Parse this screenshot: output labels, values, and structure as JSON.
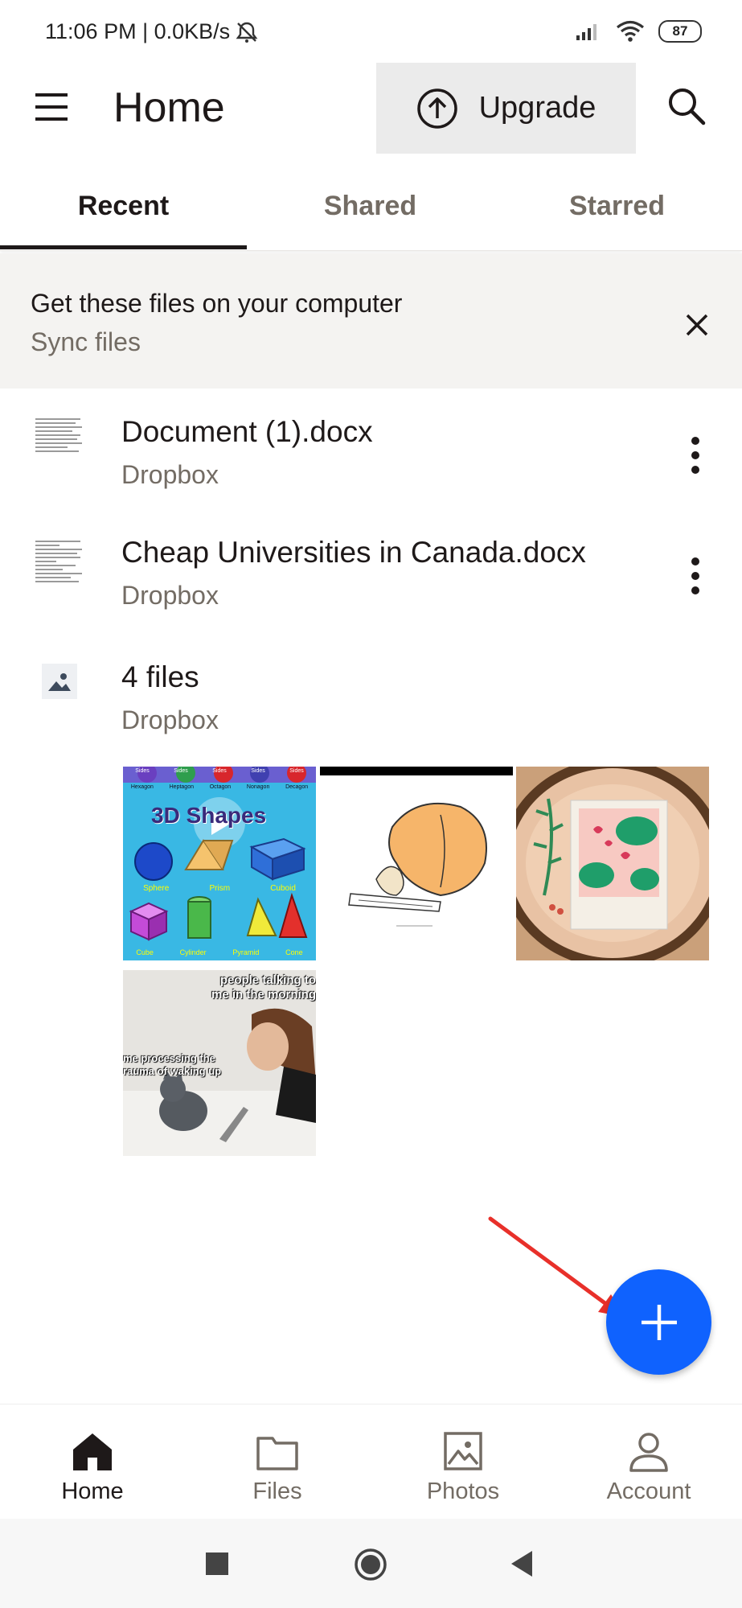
{
  "status_bar": {
    "time": "11:06 PM | 0.0KB/s",
    "battery": "87"
  },
  "app_bar": {
    "title": "Home",
    "upgrade_label": "Upgrade"
  },
  "tabs": [
    {
      "label": "Recent",
      "active": true
    },
    {
      "label": "Shared",
      "active": false
    },
    {
      "label": "Starred",
      "active": false
    }
  ],
  "banner": {
    "title": "Get these files on your computer",
    "subtitle": "Sync files"
  },
  "files": [
    {
      "name": "Document (1).docx",
      "location": "Dropbox",
      "icon": "docx-thumbnail"
    },
    {
      "name": "Cheap Universities in Canada.docx",
      "location": "Dropbox",
      "icon": "docx-thumbnail"
    },
    {
      "name": "4 files",
      "location": "Dropbox",
      "icon": "image-icon"
    }
  ],
  "photos": {
    "shapes": {
      "header_labels": [
        "Sides",
        "Sides",
        "Sides",
        "Sides",
        "Sides"
      ],
      "shape_names_top": [
        "Hexagon",
        "Heptagon",
        "Octagon",
        "Nonagon",
        "Decagon"
      ],
      "title": "3D Shapes",
      "row1": [
        "Sphere",
        "Prism",
        "Cuboid"
      ],
      "row2": [
        "Cube",
        "Cylinder",
        "Pyramid",
        "Cone"
      ]
    },
    "meme": {
      "top_text": "people talking to me in the morning",
      "side_text": "me processing the rauma of waking up"
    }
  },
  "bottom_nav": [
    {
      "label": "Home",
      "icon": "home-icon",
      "active": true
    },
    {
      "label": "Files",
      "icon": "folder-icon",
      "active": false
    },
    {
      "label": "Photos",
      "icon": "photos-icon",
      "active": false
    },
    {
      "label": "Account",
      "icon": "account-icon",
      "active": false
    }
  ],
  "colors": {
    "accent": "#0f62fe",
    "annotation_arrow": "#e8302a",
    "text_primary": "#1e1919",
    "text_secondary": "#736c64"
  }
}
